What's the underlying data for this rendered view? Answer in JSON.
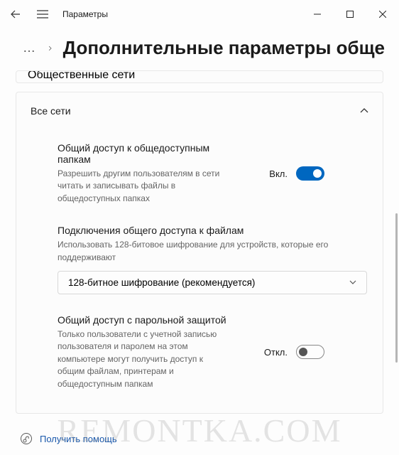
{
  "window": {
    "title": "Параметры"
  },
  "header": {
    "dots": "…",
    "title": "Дополнительные параметры обще"
  },
  "collapsed": {
    "title": "Общественные сети"
  },
  "section": {
    "title": "Все сети",
    "pubfolder": {
      "title": "Общий доступ к общедоступным папкам",
      "desc": "Разрешить другим пользователям в сети читать и записывать файлы в общедоступных папках",
      "state": "Вкл."
    },
    "filesharing": {
      "title": "Подключения общего доступа к файлам",
      "desc": "Использовать 128-битовое шифрование для устройств, которые его поддерживают",
      "dropdown": "128-битное шифрование (рекомендуется)"
    },
    "password": {
      "title": "Общий доступ с парольной защитой",
      "desc": "Только пользователи с учетной записью пользователя и паролем на этом компьютере могут получить доступ к общим файлам, принтерам и общедоступным папкам",
      "state": "Откл."
    }
  },
  "footer": {
    "help": "Получить помощь"
  },
  "watermark": "REMONTKA.COM"
}
